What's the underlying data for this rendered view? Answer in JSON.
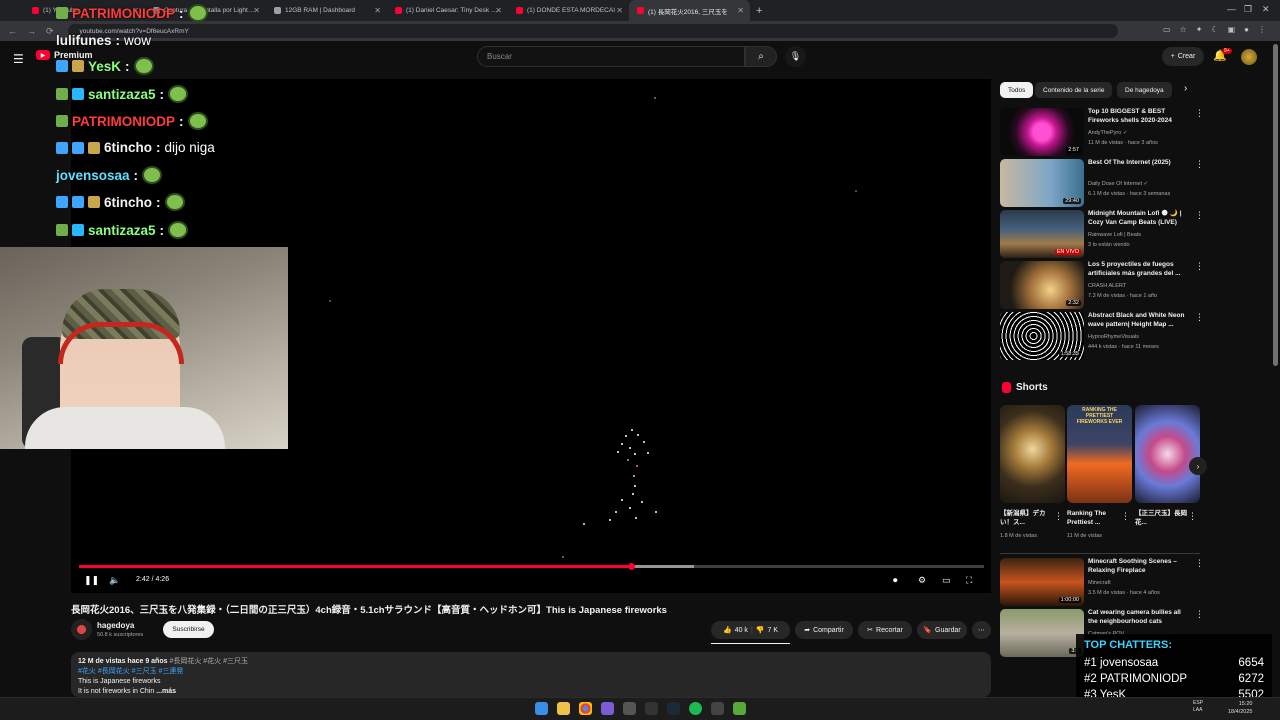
{
  "browser": {
    "tabs": [
      {
        "title": "(1) YouTube",
        "favicon": "youtube",
        "active": false
      },
      {
        "title": "Captura de pantalla por Lightshot",
        "favicon": "generic",
        "active": false
      },
      {
        "title": "12GB RAM | Dashboard",
        "favicon": "generic",
        "active": false
      },
      {
        "title": "(1) Daniel Caesar: Tiny Desk Con",
        "favicon": "youtube",
        "active": false
      },
      {
        "title": "(1) DONDE ESTA MORDECAI",
        "favicon": "youtube",
        "active": false
      },
      {
        "title": "(1) 長岡花火2016, 三尺玉を",
        "favicon": "youtube",
        "active": true
      }
    ],
    "url": "youtube.com/watch?v=Df6eucAxRmY"
  },
  "header": {
    "logo_label": "Premium",
    "logo_region": "AR",
    "search_placeholder": "Buscar",
    "create_label": "Crear",
    "notifications_count": "9+"
  },
  "player": {
    "time_current": "2:42",
    "time_total": "4:26",
    "time_display": "2:42 / 4:26",
    "played_fraction": 0.61,
    "loaded_fraction": 0.68,
    "accent": "#ff0033"
  },
  "chat_overlay": [
    {
      "user": "PATRIMONIODP",
      "color": "#ff3b3b",
      "message": "",
      "badges": [
        "hat"
      ]
    },
    {
      "user": "lulifunes",
      "color": "#f1f1f1",
      "message": "wow",
      "badges": []
    },
    {
      "user": "YesK",
      "color": "#8cff80",
      "message": "",
      "badges": [
        "sword",
        "gear"
      ]
    },
    {
      "user": "santizaza5",
      "color": "#8cff80",
      "message": "",
      "badges": [
        "hat",
        "cube"
      ]
    },
    {
      "user": "PATRIMONIODP",
      "color": "#ff3b3b",
      "message": "",
      "badges": [
        "hat"
      ]
    },
    {
      "user": "6tincho",
      "color": "#f1f1f1",
      "message": "dijo niga",
      "badges": [
        "sword",
        "qr",
        "coin"
      ]
    },
    {
      "user": "jovensosaa",
      "color": "#5fe0ff",
      "message": "",
      "badges": []
    },
    {
      "user": "6tincho",
      "color": "#f1f1f1",
      "message": "",
      "badges": [
        "sword",
        "qr",
        "coin"
      ]
    },
    {
      "user": "santizaza5",
      "color": "#8cff80",
      "message": "",
      "badges": [
        "hat",
        "cube"
      ]
    }
  ],
  "video": {
    "title": "長岡花火2016、三尺玉を八発集録・（二日間の正三尺玉）4ch録音・5.1chサラウンド【高音質・ヘッドホン可】This is Japanese fireworks",
    "channel": "hagedoya",
    "subscribers": "50.8 k suscriptores",
    "subscribe_label": "Suscribirse",
    "likes": "40 k",
    "dislikes": "7 K",
    "share_label": "Compartir",
    "clip_label": "Recortar",
    "save_label": "Guardar",
    "description": {
      "meta": "12 M de vistas  hace 9 años",
      "tags_line1": "#長岡花火 #花火 #三尺玉",
      "tags_line2": "#花火 #長岡花火 #三尺玉 #三連発",
      "line3": "This is Japanese fireworks",
      "line4": "It is not fireworks in Chin",
      "more": "...más"
    }
  },
  "sidebar": {
    "chips": [
      "Todos",
      "Contenido de la serie",
      "De hagedoya"
    ],
    "recommendations": [
      {
        "title": "Top 10 BIGGEST & BEST Fireworks shells 2020-2024",
        "channel": "AndyThePyro",
        "meta": "11 M de vistas · hace 3 años",
        "duration": "2:57",
        "verified": true
      },
      {
        "title": "Best Of The Internet (2025)",
        "channel": "Daily Dose Of Internet",
        "meta": "6.1 M de vistas · hace 3 semanas",
        "duration": "29:40",
        "verified": true
      },
      {
        "title": "Midnight Mountain Lofi 🌑 🌙 | Cozy Van Camp Beats (LIVE)",
        "channel": "Rainwave Lofi | Beats",
        "meta": "3 lo están viendo",
        "duration": "EN VIVO",
        "verified": false
      },
      {
        "title": "Los 5 proyectiles de fuegos artificiales más grandes del ...",
        "channel": "CRASH ALERT",
        "meta": "7.3 M de vistas · hace 1 año",
        "duration": "2:32",
        "verified": false
      },
      {
        "title": "Abstract Black and White Neon wave pattern| Height Map ...",
        "channel": "HypnoRhymeVisuals",
        "meta": "444 k vistas · hace 11 meses",
        "duration": "1:58:35",
        "verified": false
      }
    ],
    "shorts_title": "Shorts",
    "shorts": [
      {
        "title": "【新潟県】デカい！ス...",
        "views": "1.8 M de vistas",
        "overlay": ""
      },
      {
        "title": "Ranking The Prettiest ...",
        "views": "11 M de vistas",
        "overlay": "RANKING THE PRETTIEST FIREWORKS EVER"
      },
      {
        "title": "【正三尺玉】長岡花...",
        "views": "",
        "overlay": ""
      }
    ],
    "more_recs": [
      {
        "title": "Minecraft Soothing Scenes – Relaxing Fireplace",
        "channel": "Minecraft",
        "meta": "3.5 M de vistas · hace 4 años",
        "duration": "1:00:00"
      },
      {
        "title": "Cat wearing camera bullies all the neighbourhood cats",
        "channel": "Catman's POV",
        "meta": "",
        "duration": "3:2"
      }
    ]
  },
  "top_chatters": {
    "title": "TOP CHATTERS:",
    "rows": [
      {
        "rank": "#1",
        "name": "jovensosaa",
        "count": "6654"
      },
      {
        "rank": "#2",
        "name": "PATRIMONIODP",
        "count": "6272"
      },
      {
        "rank": "#3",
        "name": "YesK",
        "count": "5502"
      }
    ]
  },
  "taskbar": {
    "lang_line1": "ESP",
    "lang_line2": "LAA",
    "time": "15:20",
    "date": "18/4/2025"
  }
}
